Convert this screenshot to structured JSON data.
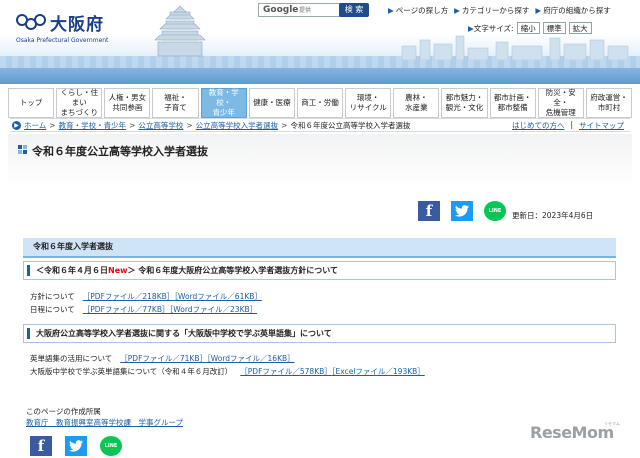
{
  "header": {
    "logo_jp": "大阪府",
    "logo_en": "Osaka Prefectural Government",
    "search_brand": "Google",
    "search_placeholder": "提供",
    "search_button": "検 索",
    "top_links": [
      "ページの探し方",
      "カテゴリーから探す",
      "府庁の組織から探す"
    ],
    "text_size_label": "文字サイズ:",
    "text_size_options": [
      "縮小",
      "標準",
      "拡大"
    ]
  },
  "nav": [
    {
      "label": "トップ"
    },
    {
      "label": "くらし・住まい\nまちづくり"
    },
    {
      "label": "人権・男女\n共同参画"
    },
    {
      "label": "福祉・\n子育て"
    },
    {
      "label": "教育・学校・\n青少年",
      "active": true
    },
    {
      "label": "健康・医療"
    },
    {
      "label": "商工・労働"
    },
    {
      "label": "環境・\nリサイクル"
    },
    {
      "label": "農林・\n水産業"
    },
    {
      "label": "都市魅力・\n観光・文化"
    },
    {
      "label": "都市計画・\n都市整備"
    },
    {
      "label": "防災・安全・\n危機管理"
    },
    {
      "label": "府政運営・\n市町村"
    }
  ],
  "breadcrumb": {
    "items": [
      "ホーム",
      "教育・学校・青少年",
      "公立高等学校",
      "公立高等学校入学者選抜"
    ],
    "current": "令和６年度公立高等学校入学者選抜",
    "right_links": [
      "はじめての方へ",
      "サイトマップ"
    ]
  },
  "page": {
    "title": "令和６年度公立高等学校入学者選抜",
    "updated": "更新日：2023年4月6日"
  },
  "social": {
    "facebook": "f",
    "twitter": "t",
    "line": "LINE"
  },
  "content": {
    "section_title": "令和６年度入学者選抜",
    "block1": {
      "heading_pre": "＜令和６年４月６日",
      "heading_new": "New",
      "heading_post": "＞ 令和６年度大阪府公立高等学校入学者選抜方針について",
      "rows": [
        {
          "label": "方針について",
          "pdf": "［PDFファイル／218KB］",
          "word": "［Wordファイル／61KB］"
        },
        {
          "label": "日程について",
          "pdf": "［PDFファイル／77KB］",
          "word": "［Wordファイル／23KB］"
        }
      ]
    },
    "block2": {
      "heading": "大阪府公立高等学校入学者選抜に関する「大阪版中学校で学ぶ英単語集」について",
      "rows": [
        {
          "label": "英単語集の活用について",
          "pdf": "［PDFファイル／71KB］",
          "word": "［Wordファイル／16KB］"
        },
        {
          "label": "大阪版中学校で学ぶ英単語集について（令和４年６月改訂）",
          "pdf": "［PDFファイル／578KB］",
          "word": "［Excelファイル／193KB］"
        }
      ]
    }
  },
  "footer": {
    "label": "このページの作成所属",
    "department": "教育庁　教育振興室高等学校課　学事グループ"
  },
  "watermark": {
    "text": "ReseMom",
    "sub": "リセマム"
  },
  "colors": {
    "brand": "#1a3f86",
    "link": "#1a5fa8",
    "active_nav": "#7db9e5",
    "new": "#e60012"
  }
}
